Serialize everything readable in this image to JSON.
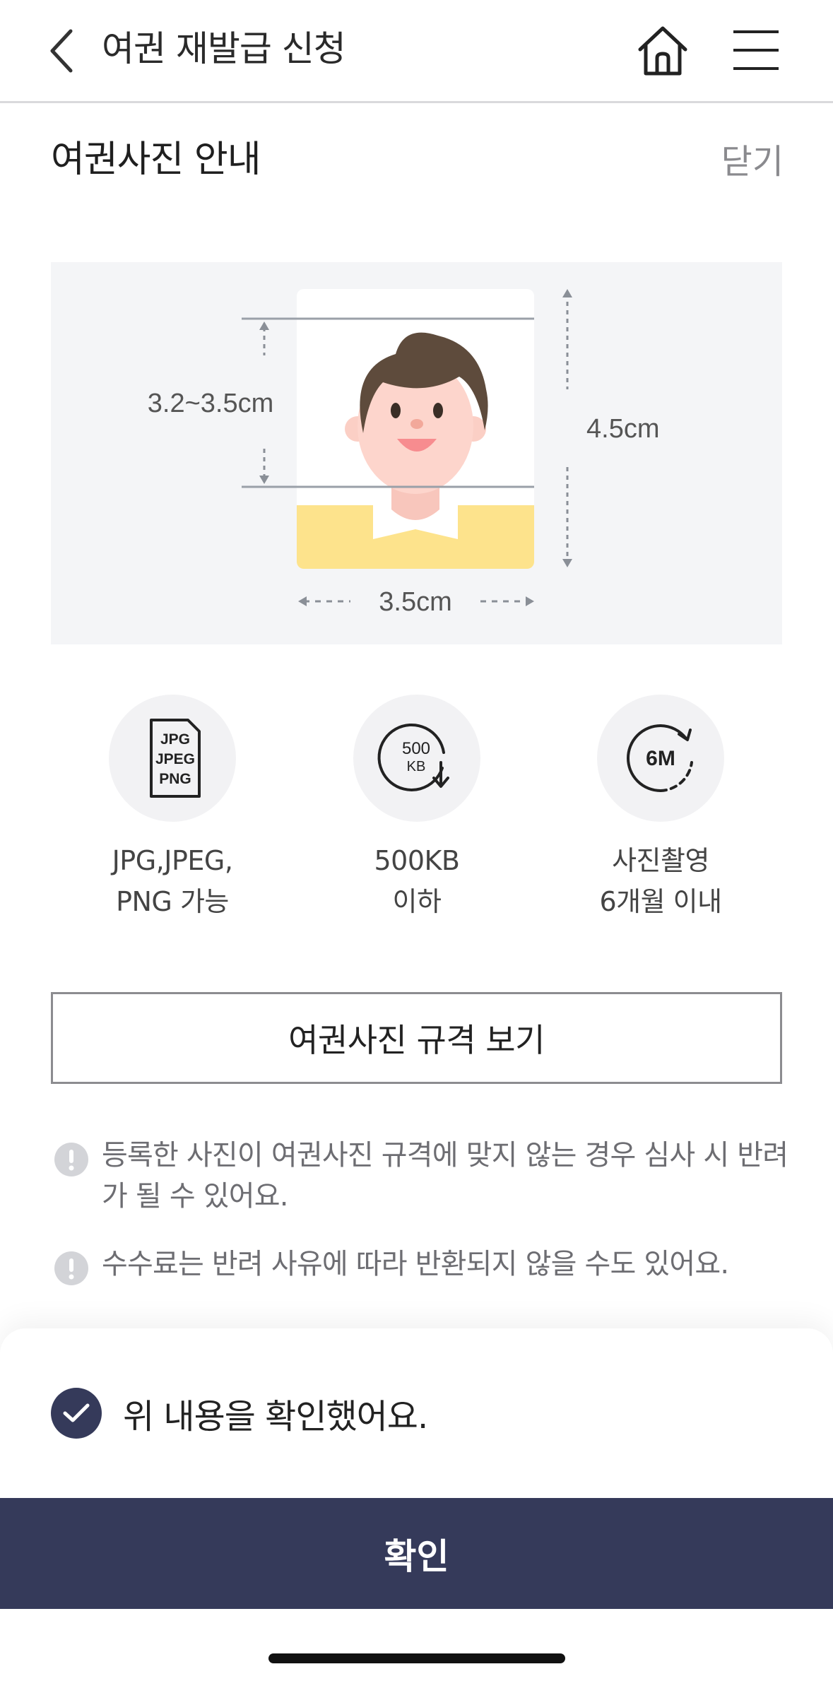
{
  "header": {
    "title": "여권 재발급 신청",
    "back_icon": "chevron-left-icon",
    "home_icon": "home-icon",
    "menu_icon": "hamburger-menu-icon"
  },
  "guide": {
    "title": "여권사진 안내",
    "close_label": "닫기"
  },
  "photo_diagram": {
    "face_height_label": "3.2~3.5cm",
    "photo_height_label": "4.5cm",
    "photo_width_label": "3.5cm"
  },
  "specs": [
    {
      "icon": "file-format-icon",
      "icon_text": [
        "JPG",
        "JPEG",
        "PNG"
      ],
      "line1": "JPG,JPEG,",
      "line2": "PNG 가능"
    },
    {
      "icon": "file-size-icon",
      "icon_text": [
        "500",
        "KB"
      ],
      "line1": "500KB",
      "line2": "이하"
    },
    {
      "icon": "six-month-icon",
      "icon_text": [
        "6M"
      ],
      "line1": "사진촬영",
      "line2": "6개월 이내"
    }
  ],
  "spec_button_label": "여권사진 규격 보기",
  "notices": [
    {
      "icon": "exclamation-icon",
      "text": "등록한 사진이 여권사진 규격에 맞지 않는 경우 심사 시 반려가 될 수 있어요."
    },
    {
      "icon": "exclamation-icon",
      "text": "수수료는 반려 사유에 따라 반환되지 않을 수도 있어요."
    }
  ],
  "confirm_check": {
    "label": "위 내용을 확인했어요.",
    "checked": true
  },
  "confirm_button_label": "확인",
  "colors": {
    "primary": "#353a5a",
    "panel_bg": "#f4f5f7",
    "hair": "#5e4b3c",
    "skin": "#fdd5cc",
    "shirt": "#fde38c"
  }
}
